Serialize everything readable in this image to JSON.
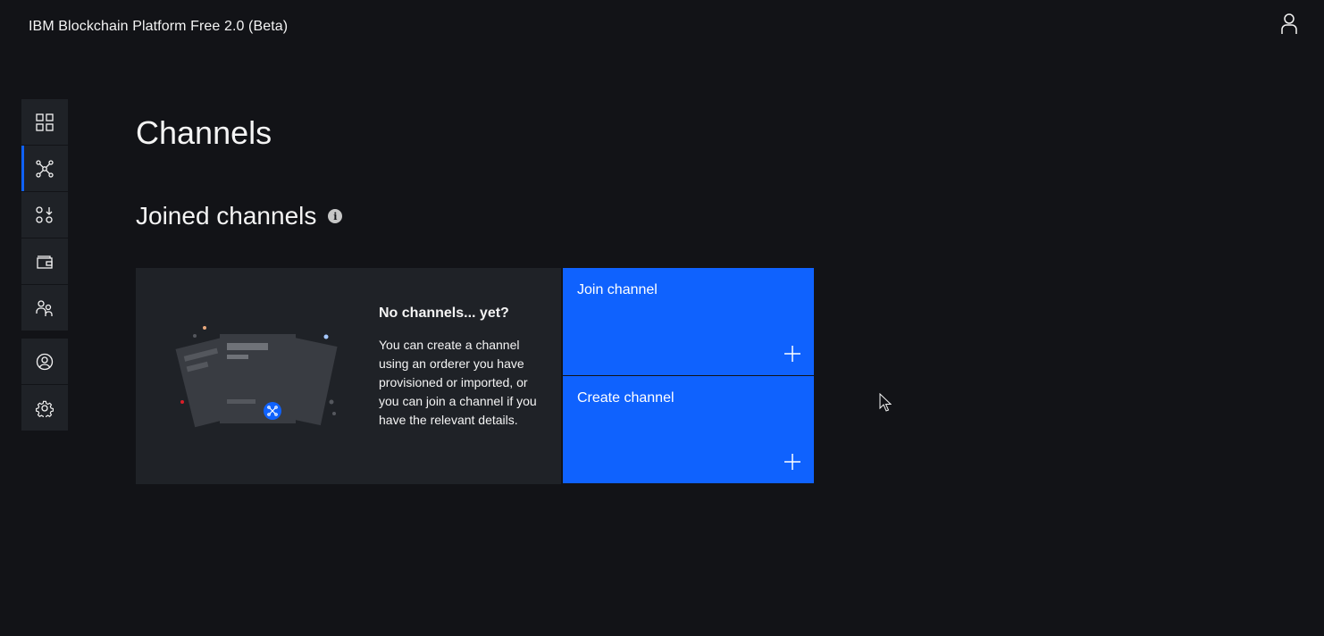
{
  "header": {
    "title": "IBM Blockchain Platform Free 2.0 (Beta)",
    "user_icon": "user-icon"
  },
  "sidenav": {
    "items": [
      {
        "icon": "dashboard-grid-icon",
        "active": false
      },
      {
        "icon": "network-channels-icon",
        "active": true
      },
      {
        "icon": "smart-contracts-icon",
        "active": false
      },
      {
        "icon": "wallet-icon",
        "active": false
      },
      {
        "icon": "users-icon",
        "active": false
      },
      {
        "icon": "user-profile-icon",
        "active": false
      },
      {
        "icon": "settings-gear-icon",
        "active": false
      }
    ]
  },
  "main": {
    "title": "Channels",
    "section_title": "Joined channels",
    "info_icon": "info-icon",
    "empty_state": {
      "heading": "No channels... yet?",
      "text": "You can create a channel using an orderer you have provisioned or imported, or you can join a channel if you have the relevant details."
    },
    "tiles": [
      {
        "label": "Join channel",
        "icon": "plus-icon"
      },
      {
        "label": "Create channel",
        "icon": "plus-icon"
      }
    ]
  },
  "colors": {
    "background": "#121317",
    "panel": "#1f2227",
    "accent": "#0f62fe"
  }
}
